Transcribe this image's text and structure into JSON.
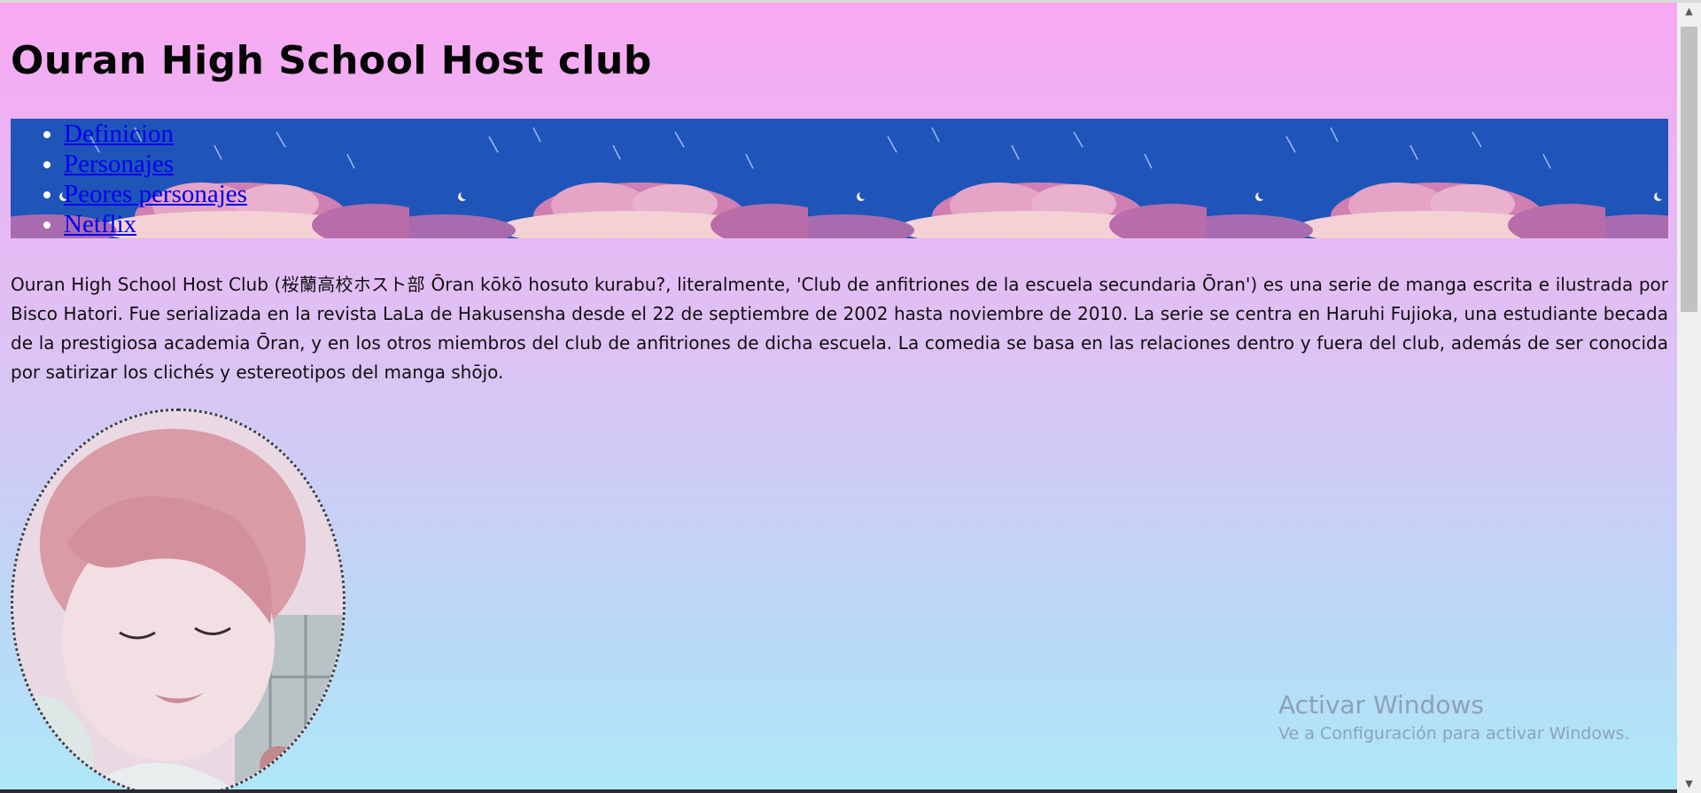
{
  "page": {
    "title": "Ouran High School Host club"
  },
  "nav": {
    "items": [
      {
        "label": "Definicion"
      },
      {
        "label": "Personajes"
      },
      {
        "label": "Peores personajes"
      },
      {
        "label": "Netflix"
      }
    ]
  },
  "intro": {
    "text": "Ouran High School Host Club (桜蘭高校ホスト部 Ōran kōkō hosuto kurabu?, literalmente, 'Club de anfitriones de la escuela secundaria Ōran') es una serie de manga escrita e ilustrada por Bisco Hatori. Fue serializada en la revista LaLa de Hakusensha desde el 22 de septiembre de 2002 hasta noviembre de 2010. La serie se centra en Haruhi Fujioka, una estudiante becada de la prestigiosa academia Ōran, y en los otros miembros del club de anfitriones de dicha escuela. La comedia se basa en las relaciones dentro y fuera del club, además de ser conocida por satirizar los clichés y estereotipos del manga shōjo."
  },
  "watermark": {
    "title": "Activar Windows",
    "subtitle": "Ve a Configuración para activar Windows."
  },
  "colors": {
    "gradient_top": "#f8a8f2",
    "gradient_bottom": "#aee8f8",
    "banner_sky": "#1f55b8",
    "link": "#0000ee",
    "text": "#101010"
  },
  "icons": {
    "banner": "night-sky-clouds-image",
    "portrait": "anime-character-portrait-image",
    "scroll_up": "scroll-up-arrow-icon",
    "scroll_down": "scroll-down-arrow-icon"
  }
}
